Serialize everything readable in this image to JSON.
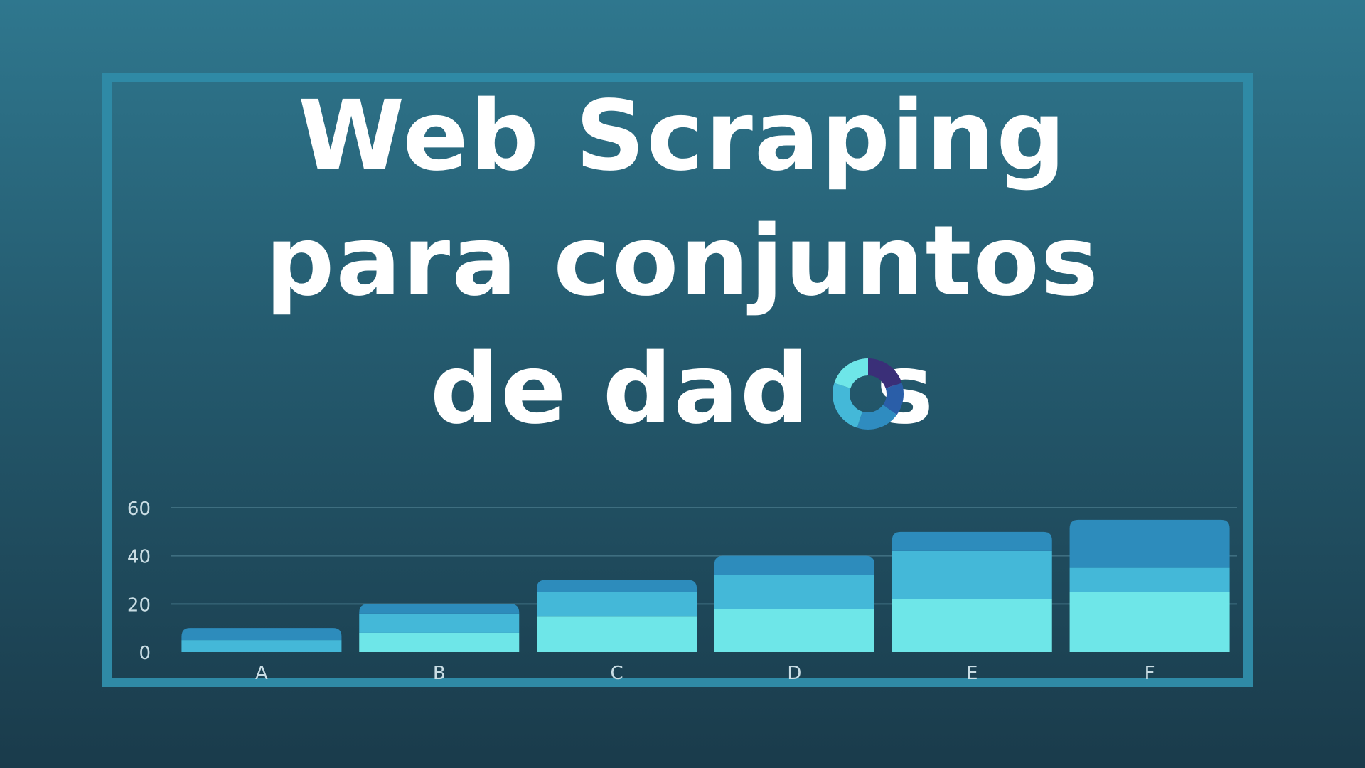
{
  "title": {
    "line1": "Web Scraping",
    "line2": "para conjuntos",
    "line3_before": "de dad",
    "line3_after": "s"
  },
  "colors": {
    "frame": "#2f8aa6",
    "segment_light": "#6ee6e8",
    "segment_mid": "#44b8d8",
    "segment_dark": "#2d8cbc",
    "gridline": "#3e6e80",
    "tick_text": "#c9dde4",
    "donut": [
      "#3a2f78",
      "#2a5ea8",
      "#2f8cc0",
      "#44b8d8",
      "#6ee6e8"
    ]
  },
  "chart_data": {
    "type": "bar",
    "stacked": true,
    "categories": [
      "A",
      "B",
      "C",
      "D",
      "E",
      "F"
    ],
    "series": [
      {
        "values": [
          0,
          8,
          15,
          18,
          22,
          25
        ],
        "color": "#6ee6e8"
      },
      {
        "values": [
          5,
          8,
          10,
          14,
          20,
          10
        ],
        "color": "#44b8d8"
      },
      {
        "values": [
          5,
          4,
          5,
          8,
          8,
          20
        ],
        "color": "#2d8cbc"
      }
    ],
    "yticks": [
      "0",
      "20",
      "40",
      "60"
    ],
    "ylim": [
      0,
      60
    ],
    "grid": true,
    "legend": "none"
  }
}
